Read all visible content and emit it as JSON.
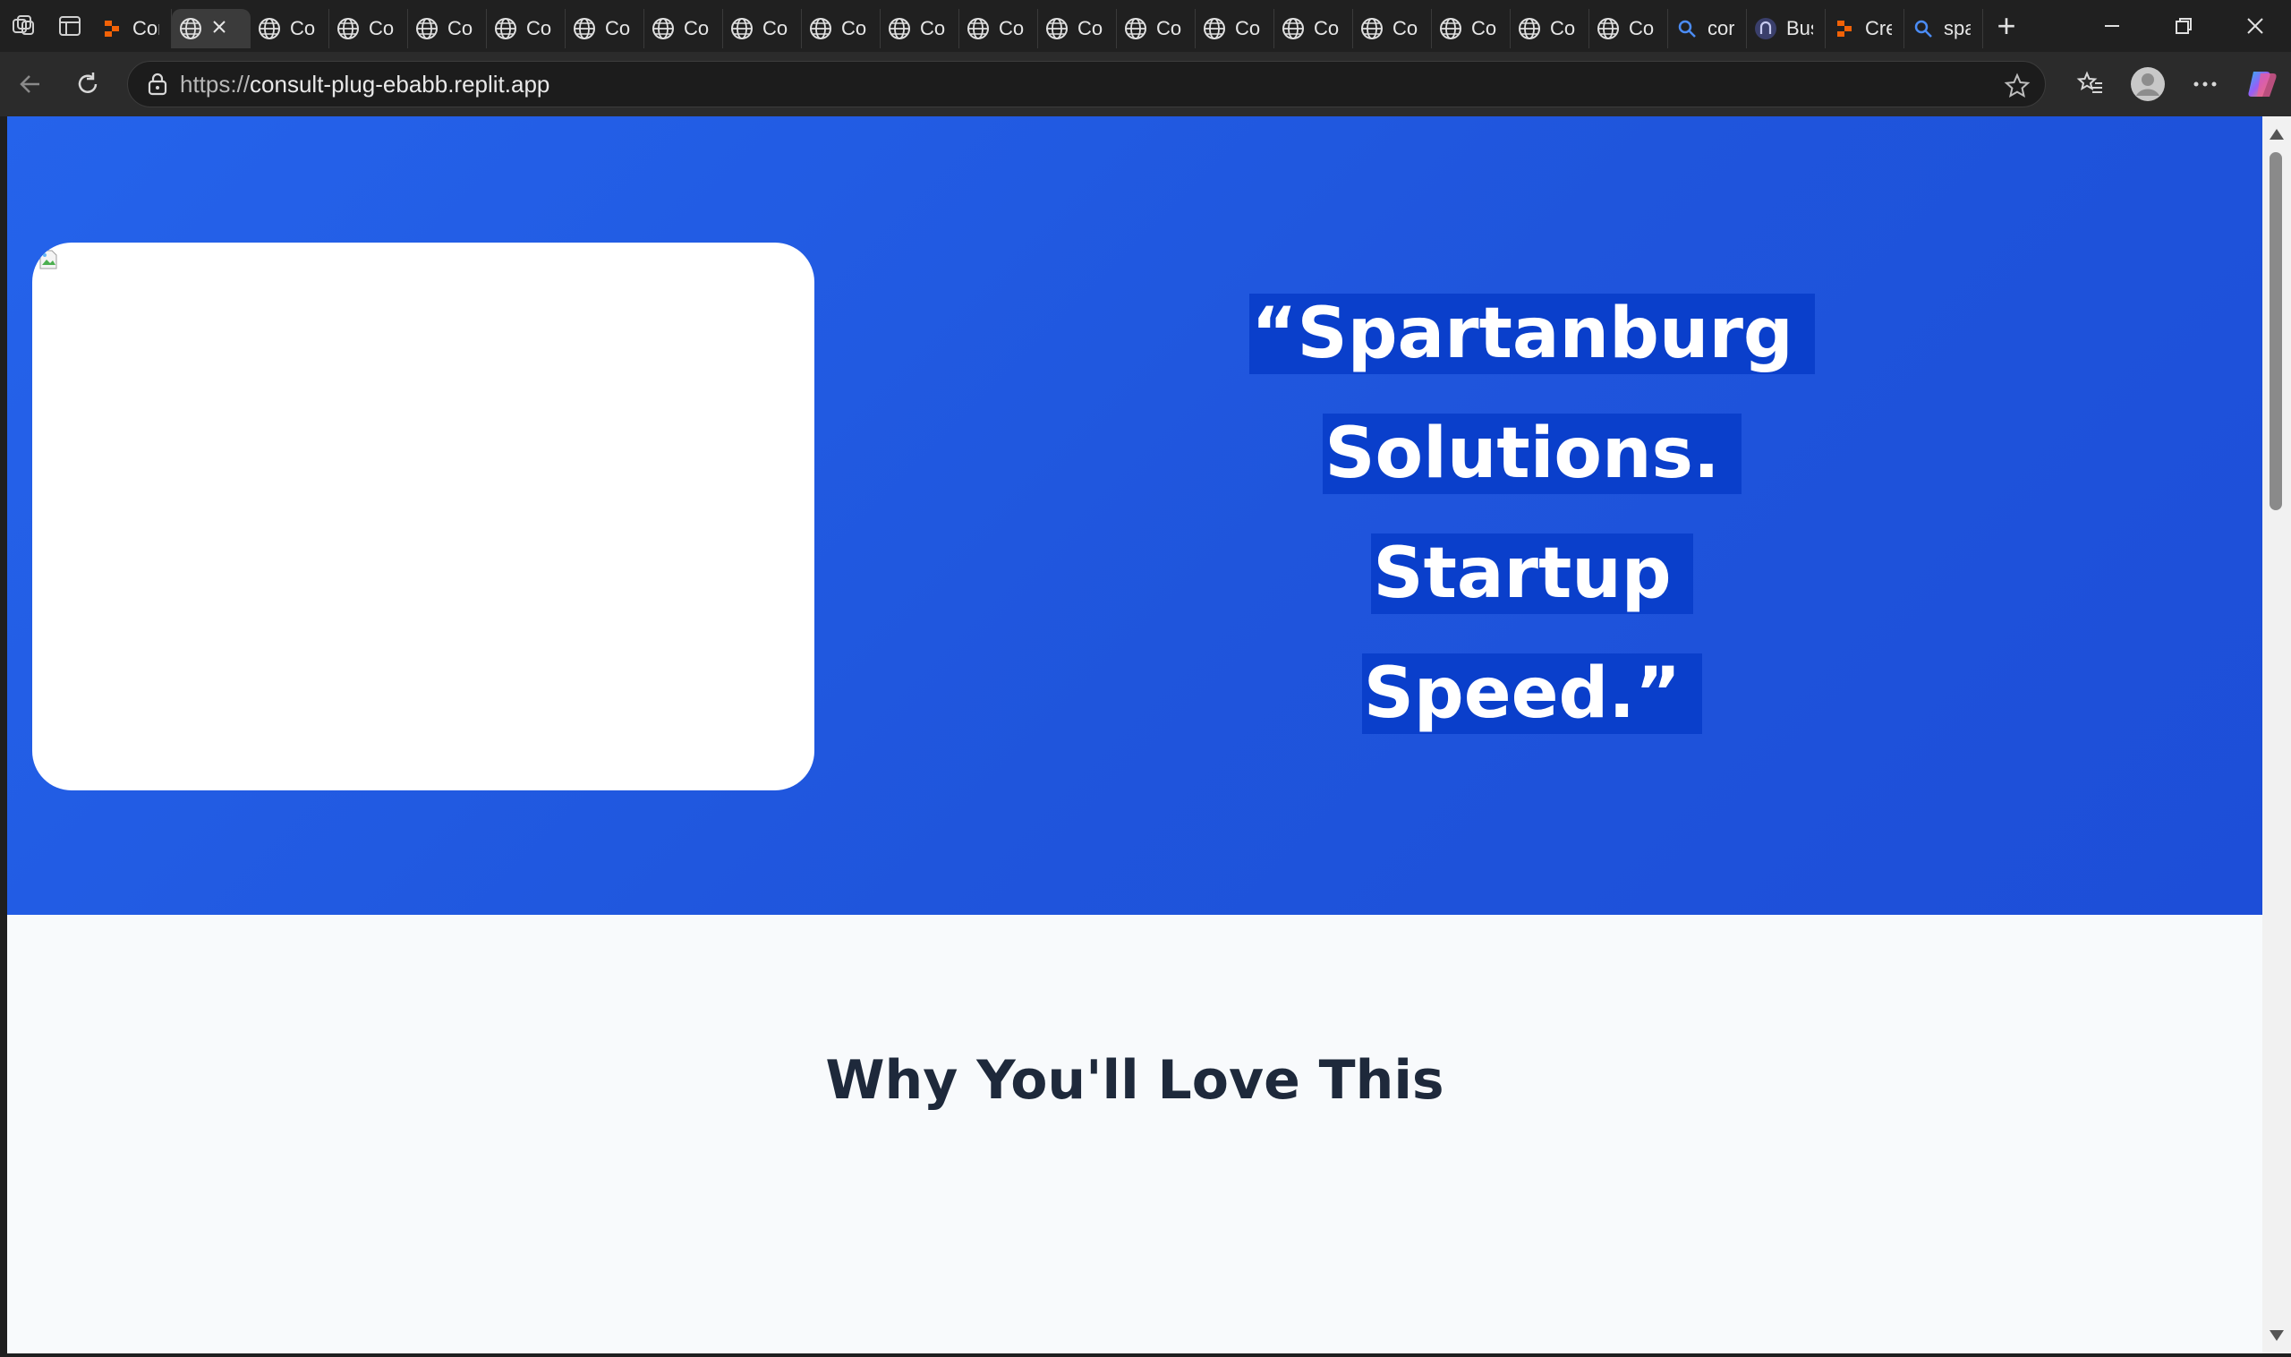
{
  "browser": {
    "tabs": [
      {
        "label": "Cor",
        "favicon": "replit-icon"
      },
      {
        "label": "",
        "favicon": "globe-icon",
        "active": true
      },
      {
        "label": "Co",
        "favicon": "globe-icon"
      },
      {
        "label": "Co",
        "favicon": "globe-icon"
      },
      {
        "label": "Co",
        "favicon": "globe-icon"
      },
      {
        "label": "Co",
        "favicon": "globe-icon"
      },
      {
        "label": "Co",
        "favicon": "globe-icon"
      },
      {
        "label": "Co",
        "favicon": "globe-icon"
      },
      {
        "label": "Co",
        "favicon": "globe-icon"
      },
      {
        "label": "Co",
        "favicon": "globe-icon"
      },
      {
        "label": "Co",
        "favicon": "globe-icon"
      },
      {
        "label": "Co",
        "favicon": "globe-icon"
      },
      {
        "label": "Co",
        "favicon": "globe-icon"
      },
      {
        "label": "Co",
        "favicon": "globe-icon"
      },
      {
        "label": "Co",
        "favicon": "globe-icon"
      },
      {
        "label": "Co",
        "favicon": "globe-icon"
      },
      {
        "label": "Co",
        "favicon": "globe-icon"
      },
      {
        "label": "Co",
        "favicon": "globe-icon"
      },
      {
        "label": "Co",
        "favicon": "globe-icon"
      },
      {
        "label": "Co",
        "favicon": "globe-icon"
      },
      {
        "label": "cor",
        "favicon": "search-icon"
      },
      {
        "label": "Bus",
        "favicon": "app-icon"
      },
      {
        "label": "Cre",
        "favicon": "replit-icon"
      },
      {
        "label": "spa",
        "favicon": "search-icon"
      }
    ],
    "url_scheme": "https://",
    "url_host": "consult-plug-ebabb.replit.app"
  },
  "hero": {
    "quote_lines": [
      "“Spartanburg",
      "Solutions.",
      "Startup",
      "Speed.”"
    ]
  },
  "features": {
    "heading": "Why You'll Love This"
  },
  "colors": {
    "hero_bg": "#2563eb",
    "highlight": "#0a3fcb",
    "heading": "#1e293b"
  }
}
